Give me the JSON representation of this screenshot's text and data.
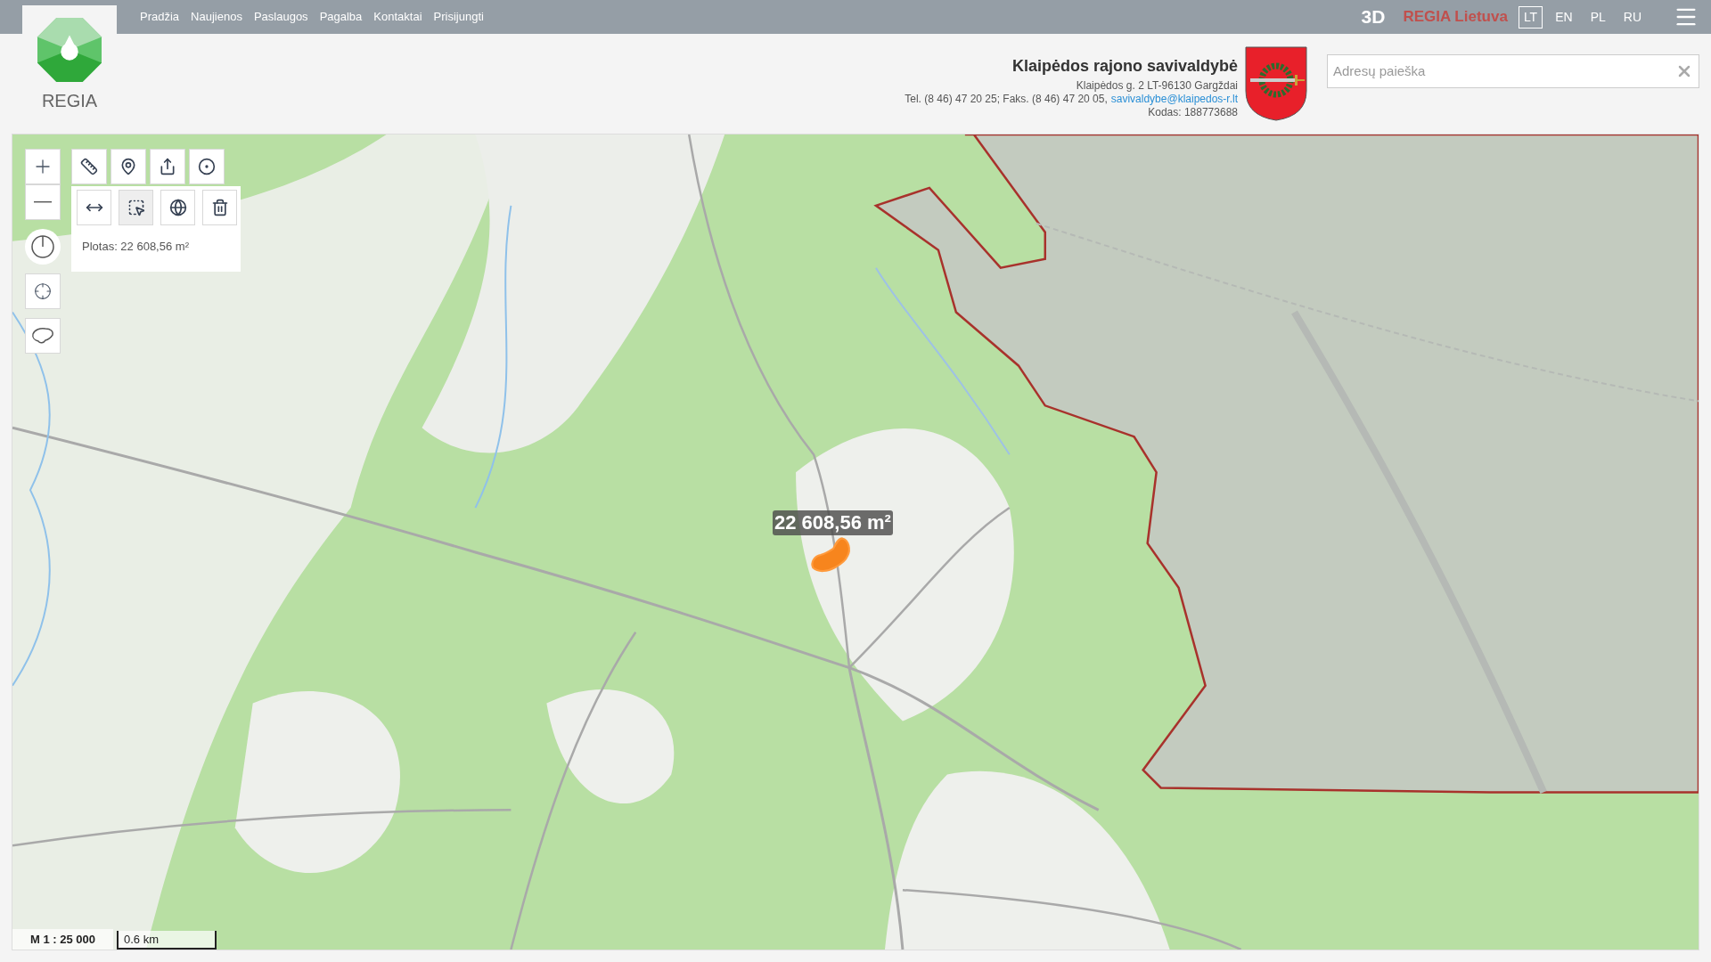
{
  "logo": {
    "text": "REGIA"
  },
  "nav": {
    "items": [
      "Pradžia",
      "Naujienos",
      "Paslaugos",
      "Pagalba",
      "Kontaktai",
      "Prisijungti"
    ]
  },
  "top_right": {
    "mode": "3D",
    "brand": "REGIA Lietuva",
    "languages": [
      {
        "label": "LT",
        "selected": true
      },
      {
        "label": "EN",
        "selected": false
      },
      {
        "label": "PL",
        "selected": false
      },
      {
        "label": "RU",
        "selected": false
      }
    ]
  },
  "municipality": {
    "name": "Klaipėdos rajono savivaldybė",
    "address": "Klaipėdos g. 2 LT-96130 Gargždai",
    "contacts": "Tel. (8 46) 47 20 25; Faks. (8 46) 47 20 05,",
    "email": "savivaldybe@klaipedos-r.lt",
    "code": "Kodas: 188773688"
  },
  "search": {
    "placeholder": "Adresų paieška"
  },
  "map": {
    "measure_tools": [
      {
        "kind": "distance",
        "selected": false
      },
      {
        "kind": "area",
        "selected": true
      },
      {
        "kind": "pick",
        "selected": false
      },
      {
        "kind": "delete",
        "selected": false
      }
    ],
    "measurement_result": "Plotas: 22 608,56 m²",
    "area_label": "22 608,56 m²",
    "scale": "M 1 : 25 000",
    "scale_bar": "0.6 km"
  }
}
